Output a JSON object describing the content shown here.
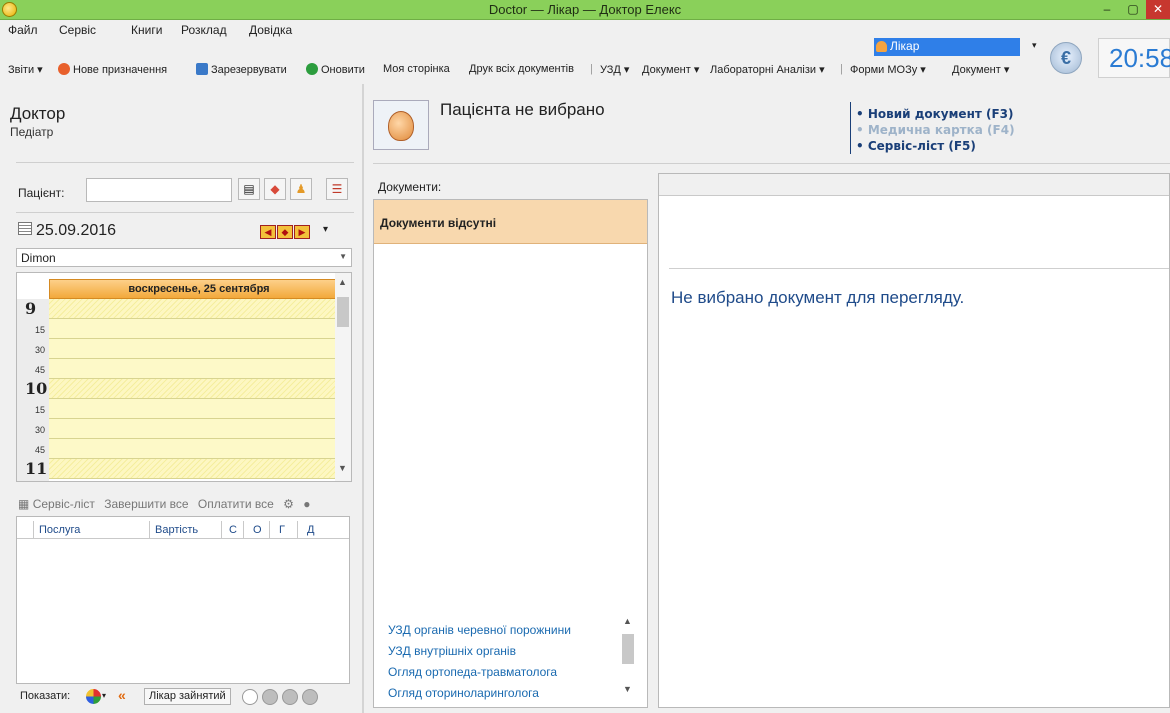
{
  "window": {
    "title": "Doctor — Лікар — Доктор Елекс",
    "minimize": "–",
    "maximize": "▢",
    "close": "✕"
  },
  "menu": [
    "Файл",
    "Сервіс",
    "Книги",
    "Розклад",
    "Довідка"
  ],
  "user": {
    "name": "Лікар",
    "clock": "20:58"
  },
  "toolbar": {
    "reports": "Звіти ▾",
    "new_appointment": "Нове призначення",
    "reserve": "Зарезервувати",
    "refresh": "Оновити",
    "my_page": "Моя сторінка",
    "print_all": "Друк всіх документів",
    "uzd": "УЗД ▾",
    "document1": "Документ ▾",
    "lab": "Лабораторні Аналізи ▾",
    "forms": "Форми МОЗу ▾",
    "document2": "Документ ▾"
  },
  "doctor": {
    "title": "Доктор",
    "specialty": "Педіатр"
  },
  "patient": {
    "label": "Пацієнт:",
    "value": ""
  },
  "calendar": {
    "date": "25.09.2016",
    "doctor_select": "Dimon",
    "day_header": "воскресенье, 25 сентября"
  },
  "schedule": {
    "rows": [
      {
        "label": "9",
        "type": "hour"
      },
      {
        "label": "15",
        "type": "minute"
      },
      {
        "label": "30",
        "type": "minute"
      },
      {
        "label": "45",
        "type": "minute"
      },
      {
        "label": "10",
        "type": "hour"
      },
      {
        "label": "15",
        "type": "minute"
      },
      {
        "label": "30",
        "type": "minute"
      },
      {
        "label": "45",
        "type": "minute"
      },
      {
        "label": "11",
        "type": "hour"
      }
    ]
  },
  "service": {
    "service_list": "Сервіс-ліст",
    "finish_all": "Завершити все",
    "pay_all": "Оплатити все",
    "columns": [
      "Послуга",
      "Вартість",
      "С",
      "О",
      "Г",
      "Д"
    ]
  },
  "show_bar": {
    "label": "Показати:",
    "busy": "Лікар зайнятий"
  },
  "header": {
    "no_patient": "Пацієнта не вибрано",
    "new_doc": "• Новий документ (F3)",
    "med_card": "• Медична картка (F4)",
    "service_sheet": "• Сервіс-ліст (F5)"
  },
  "documents": {
    "label": "Документи:",
    "none": "Документи відсутні",
    "templates": [
      "УЗД органів черевної порожнини",
      "УЗД внутрішніх органів",
      "Огляд ортопеда-травматолога",
      "Огляд оториноларинголога"
    ]
  },
  "viewer": {
    "message": "Не вибрано документ для перегляду."
  },
  "colors": {
    "titlebar": "#8ad05a",
    "accent": "#2f7fe8",
    "link": "#1a3f78",
    "schedule_head": "#f2a93b",
    "doc_selected": "#f8d8ae"
  }
}
